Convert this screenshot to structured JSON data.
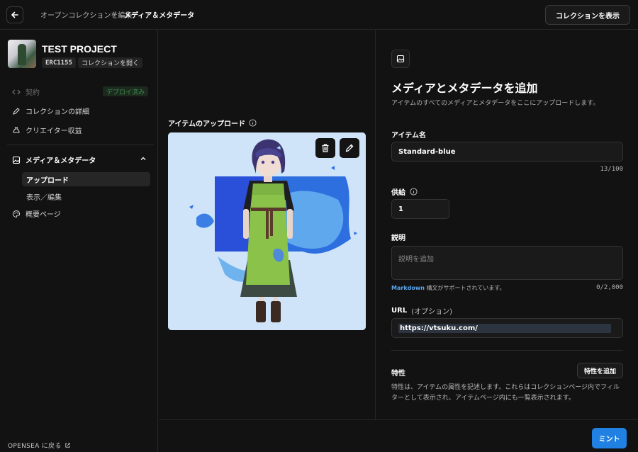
{
  "header": {
    "breadcrumb_parent": "オープンコレクションを編集",
    "breadcrumb_separator": "›",
    "breadcrumb_current": "メディア＆メタデータ",
    "view_collection": "コレクションを表示"
  },
  "sidebar": {
    "project_title": "TEST PROJECT",
    "tag_standard": "ERC1155",
    "tag_open_collection": "コレクションを開く",
    "contract_label": "契約",
    "deployed_badge": "デプロイ済み",
    "collection_details": "コレクションの詳細",
    "creator_earnings": "クリエイター収益",
    "media_section": "メディア＆メタデータ",
    "sub_upload": "アップロード",
    "sub_view_edit": "表示／編集",
    "overview_page": "概要ページ",
    "back_to_opensea": "OPENSEA に戻る"
  },
  "upload": {
    "label": "アイテムのアップロード"
  },
  "form": {
    "title": "メディアとメタデータを追加",
    "subtitle": "アイテムのすべてのメディアとメタデータをここにアップロードします。",
    "item_name_label": "アイテム名",
    "item_name_value": "Standard-blue",
    "item_name_counter": "13/100",
    "supply_label": "供給",
    "supply_value": "1",
    "description_label": "説明",
    "description_placeholder": "説明を追加",
    "markdown_word": "Markdown",
    "markdown_hint": " 構文がサポートされています。",
    "description_counter": "0/2,000",
    "url_label": "URL",
    "url_optional": "(オプション)",
    "url_value": "https://vtsuku.com/",
    "traits_label": "特性",
    "add_trait": "特性を追加",
    "traits_description": "特性は、アイテムの属性を記述します。これらはコレクションページ内でフィルターとして表示され、アイテムページ内にも一覧表示されます。"
  },
  "footer": {
    "mint": "ミント"
  },
  "colors": {
    "accent": "#2081e2",
    "background": "#121212",
    "deployed_green": "#3d8a4d",
    "markdown_link": "#5aa8f0"
  }
}
